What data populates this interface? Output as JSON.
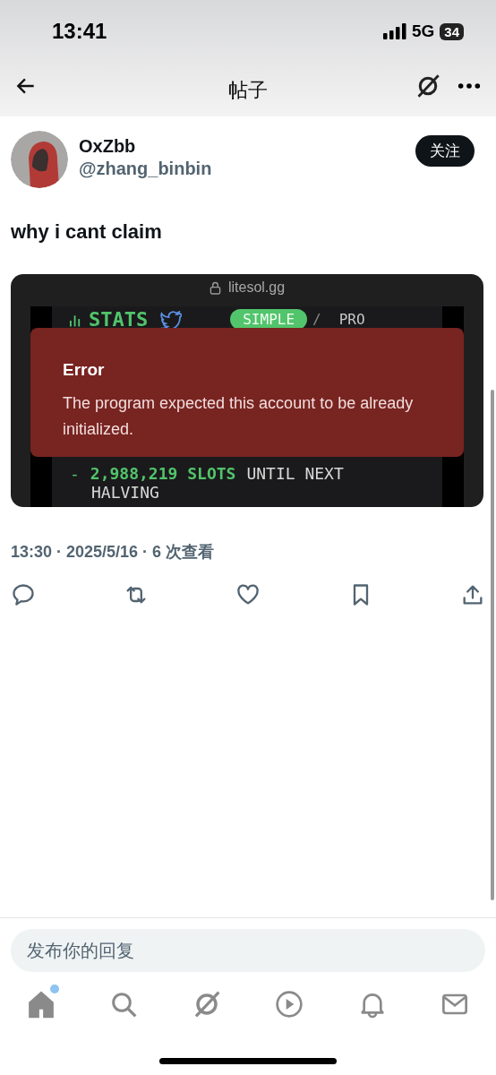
{
  "status_bar": {
    "time": "13:41",
    "network": "5G",
    "battery": "34"
  },
  "nav": {
    "title": "帖子"
  },
  "post": {
    "author": {
      "name": "OxZbb",
      "handle": "@zhang_binbin"
    },
    "follow_button": "关注",
    "text": "why i cant claim",
    "embedded_screenshot": {
      "url": "litesol.gg",
      "stats_label": "STATS",
      "modes": [
        {
          "label": "SIMPLE",
          "selected": true
        },
        {
          "label": "PRO",
          "selected": false
        }
      ],
      "separator": "/",
      "error": {
        "title": "Error",
        "message": "The program expected this account to be already initialized."
      },
      "countdown": {
        "bullet": "-",
        "value": "2,988,219 SLOTS",
        "rest": "UNTIL NEXT",
        "continuation": "HALVING"
      }
    },
    "meta": "13:30 · 2025/5/16 · **6** 次查看"
  },
  "reply": {
    "placeholder": "发布你的回复"
  },
  "tabs": [
    {
      "kind": "home",
      "selected": true,
      "badge": true
    },
    {
      "kind": "search",
      "selected": false,
      "badge": false
    },
    {
      "kind": "grok",
      "selected": false,
      "badge": false
    },
    {
      "kind": "video",
      "selected": false,
      "badge": false
    },
    {
      "kind": "notifications",
      "selected": false,
      "badge": false
    },
    {
      "kind": "messages",
      "selected": false,
      "badge": false
    }
  ]
}
